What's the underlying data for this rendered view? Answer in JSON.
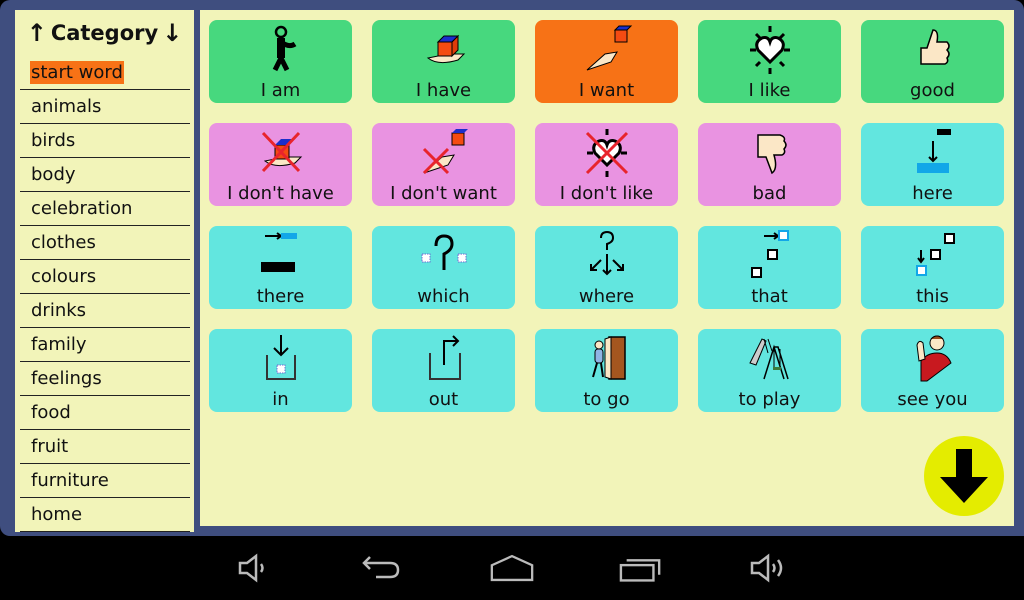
{
  "sidebar": {
    "title": "Category",
    "up_arrow": "↑",
    "down_arrow": "↓",
    "selected_index": 0,
    "categories": [
      "start word",
      "animals",
      "birds",
      "body",
      "celebration",
      "clothes",
      "colours",
      "drinks",
      "family",
      "feelings",
      "food",
      "fruit",
      "furniture",
      "home"
    ]
  },
  "board": {
    "tiles": [
      {
        "label": "I am",
        "icon": "person-pointing-self-icon",
        "color": "green"
      },
      {
        "label": "I have",
        "icon": "hand-holding-cube-icon",
        "color": "green"
      },
      {
        "label": "I want",
        "icon": "hand-reaching-cube-icon",
        "color": "orange"
      },
      {
        "label": "I like",
        "icon": "shining-heart-icon",
        "color": "green"
      },
      {
        "label": "good",
        "icon": "thumbs-up-icon",
        "color": "green"
      },
      {
        "label": "I don't have",
        "icon": "hand-cube-crossed-icon",
        "color": "pink"
      },
      {
        "label": "I don't want",
        "icon": "hand-reaching-crossed-icon",
        "color": "pink"
      },
      {
        "label": "I don't like",
        "icon": "heart-crossed-icon",
        "color": "pink"
      },
      {
        "label": "bad",
        "icon": "thumbs-down-icon",
        "color": "pink"
      },
      {
        "label": "here",
        "icon": "arrow-down-to-spot-icon",
        "color": "cyan"
      },
      {
        "label": "there",
        "icon": "arrow-to-far-spot-icon",
        "color": "cyan"
      },
      {
        "label": "which",
        "icon": "question-between-boxes-icon",
        "color": "cyan"
      },
      {
        "label": "where",
        "icon": "question-arrows-icon",
        "color": "cyan"
      },
      {
        "label": "that",
        "icon": "boxes-arrow-far-icon",
        "color": "cyan"
      },
      {
        "label": "this",
        "icon": "boxes-arrow-near-icon",
        "color": "cyan"
      },
      {
        "label": "in",
        "icon": "arrow-into-box-icon",
        "color": "cyan"
      },
      {
        "label": "out",
        "icon": "arrow-out-of-box-icon",
        "color": "cyan"
      },
      {
        "label": "to go",
        "icon": "person-exiting-door-icon",
        "color": "cyan"
      },
      {
        "label": "to play",
        "icon": "playground-slide-swing-icon",
        "color": "cyan"
      },
      {
        "label": "see you",
        "icon": "person-waving-icon",
        "color": "cyan"
      }
    ],
    "next_page_icon": "arrow-down-icon"
  },
  "colors": {
    "frame": "#3f4e7f",
    "background": "#f2f4b9",
    "green": "#47d87e",
    "orange": "#f77216",
    "pink": "#e993e1",
    "cyan": "#62e6df",
    "next_button": "#e4ec00"
  },
  "navbar": {
    "buttons": [
      "volume-down-icon",
      "back-icon",
      "home-icon",
      "recent-apps-icon",
      "volume-up-icon"
    ]
  }
}
